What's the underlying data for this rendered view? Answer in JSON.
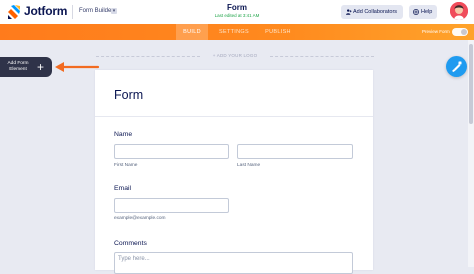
{
  "header": {
    "brand": "Jotform",
    "mode_label": "Form Builder",
    "form_title": "Form",
    "last_edited": "Last edited at 3:41 AM",
    "add_collaborators": "Add Collaborators",
    "help": "Help"
  },
  "nav": {
    "tabs": [
      {
        "label": "BUILD",
        "active": true
      },
      {
        "label": "SETTINGS",
        "active": false
      },
      {
        "label": "PUBLISH",
        "active": false
      }
    ],
    "preview_label": "Preview Form",
    "preview_on": false
  },
  "canvas": {
    "add_logo": "+ ADD YOUR LOGO",
    "add_element_label": "Add Form Element",
    "add_element_icon": "+"
  },
  "form": {
    "title": "Form",
    "fields": {
      "name": {
        "label": "Name",
        "first_sub": "First Name",
        "last_sub": "Last Name"
      },
      "email": {
        "label": "Email",
        "sub": "example@example.com"
      },
      "comments": {
        "label": "Comments",
        "placeholder": "Type here..."
      }
    }
  },
  "colors": {
    "nav_orange": "#ff7b1c",
    "accent_blue": "#1f9bf0",
    "dark_button": "#2f3349",
    "arrow_orange": "#f26b21",
    "edited_green": "#22a64b"
  },
  "icons": [
    "jotform-logo-icon",
    "chevron-down-icon",
    "user-plus-icon",
    "help-icon",
    "avatar",
    "plus-icon",
    "arrow-left-icon",
    "paint-roller-icon"
  ]
}
